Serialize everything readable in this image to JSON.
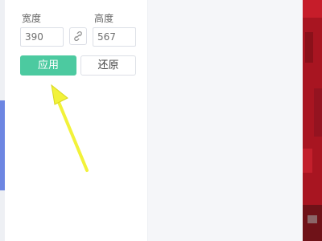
{
  "resize": {
    "width_label": "宽度",
    "height_label": "高度",
    "width_value": "390",
    "height_value": "567",
    "link_icon": "link-chain-icon"
  },
  "actions": {
    "apply_label": "应用",
    "reset_label": "还原"
  },
  "colors": {
    "apply": "#4ccaa0",
    "accent": "#6d86e2",
    "annotation_arrow": "#f2f23a"
  }
}
